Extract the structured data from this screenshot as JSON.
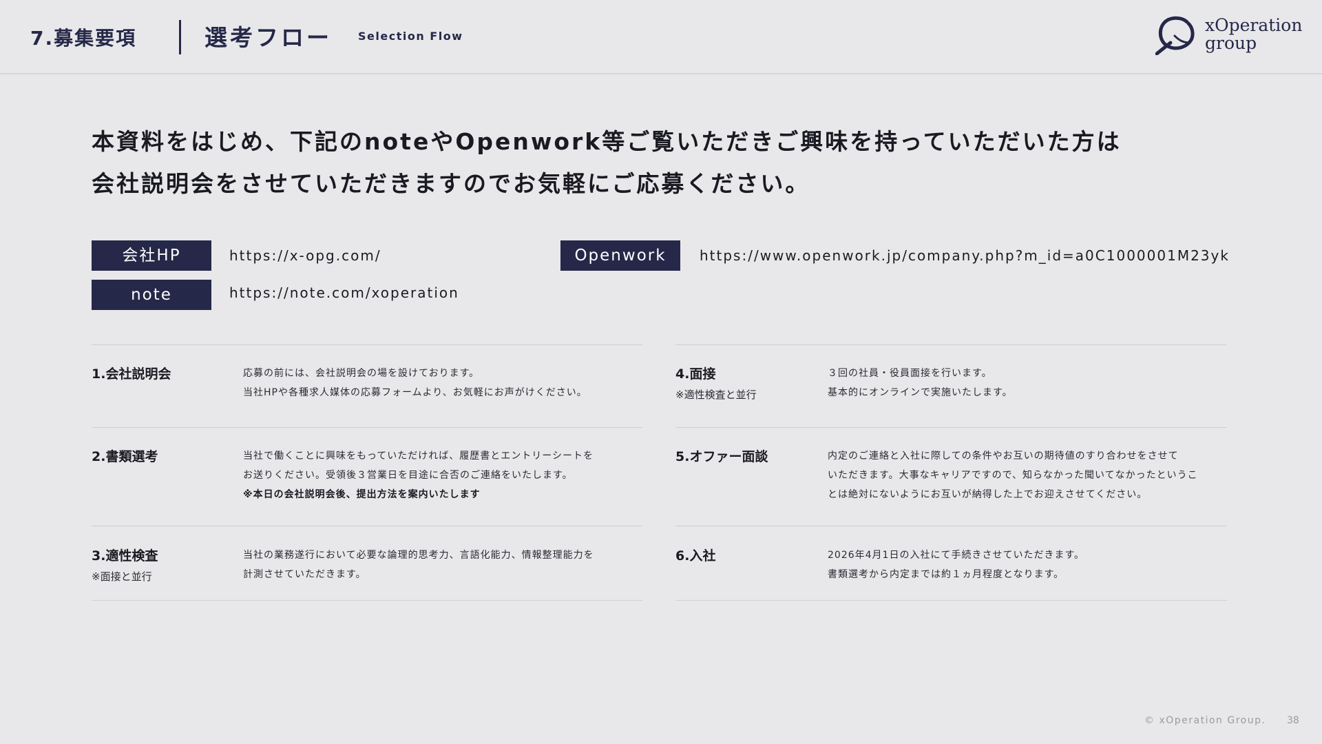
{
  "header": {
    "section": "7.募集要項",
    "title": "選考フロー",
    "subtitle": "Selection Flow",
    "logo_line1": "xOperation",
    "logo_line2": "group"
  },
  "lead": {
    "line1": "本資料をはじめ、下記のnoteやOpenwork等ご覧いただきご興味を持っていただいた方は",
    "line2": "会社説明会をさせていただきますのでお気軽にご応募ください。"
  },
  "links": [
    {
      "label": "会社HP",
      "url": "https://x-opg.com/"
    },
    {
      "label": "note",
      "url": "https://note.com/xoperation"
    },
    {
      "label": "Openwork",
      "url": "https://www.openwork.jp/company.php?m_id=a0C1000001M23yk"
    }
  ],
  "steps": [
    {
      "title": "1.会社説明会",
      "note": "",
      "lines": [
        "応募の前には、会社説明会の場を設けております。",
        "当社HPや各種求人媒体の応募フォームより、お気軽にお声がけください。"
      ],
      "bold": ""
    },
    {
      "title": "2.書類選考",
      "note": "",
      "lines": [
        "当社で働くことに興味をもっていただければ、履歴書とエントリーシートを",
        "お送りください。受領後３営業日を目途に合否のご連絡をいたします。"
      ],
      "bold": "※本日の会社説明会後、提出方法を案内いたします"
    },
    {
      "title": "3.適性検査",
      "note": "※面接と並行",
      "lines": [
        "当社の業務遂行において必要な論理的思考力、言語化能力、情報整理能力を",
        "計測させていただきます。"
      ],
      "bold": ""
    },
    {
      "title": "4.面接",
      "note": "※適性検査と並行",
      "lines": [
        "３回の社員・役員面接を行います。",
        "基本的にオンラインで実施いたします。"
      ],
      "bold": ""
    },
    {
      "title": "5.オファー面談",
      "note": "",
      "lines": [
        "内定のご連絡と入社に際しての条件やお互いの期待値のすり合わせをさせて",
        "いただきます。大事なキャリアですので、知らなかった聞いてなかったというこ",
        "とは絶対にないようにお互いが納得した上でお迎えさせてください。"
      ],
      "bold": ""
    },
    {
      "title": "6.入社",
      "note": "",
      "lines": [
        "2026年4月1日の入社にて手続きさせていただきます。",
        "書類選考から内定までは約１ヵ月程度となります。"
      ],
      "bold": ""
    }
  ],
  "footer": {
    "copyright": "© xOperation Group.",
    "page": "38"
  },
  "colors": {
    "background": "#e8e8ea",
    "navy": "#252848"
  }
}
